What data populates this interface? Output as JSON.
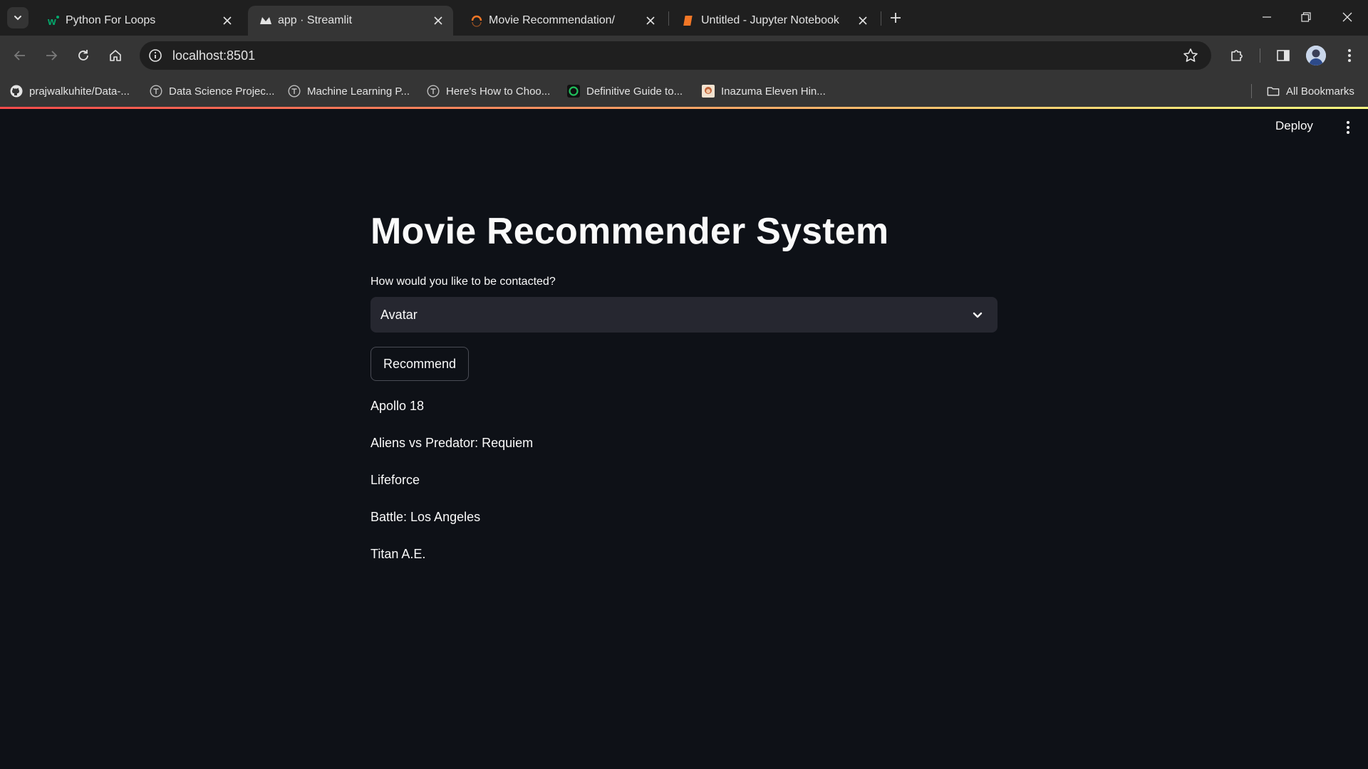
{
  "browser": {
    "tabs": [
      {
        "title": "Python For Loops",
        "icon": "w3schools-icon",
        "active": false
      },
      {
        "title": "app · Streamlit",
        "icon": "streamlit-crown-icon",
        "active": true
      },
      {
        "title": "Movie Recommendation/",
        "icon": "jupyter-loading-icon",
        "active": false
      },
      {
        "title": "Untitled - Jupyter Notebook",
        "icon": "jupyter-book-icon",
        "active": false
      }
    ],
    "address": "localhost:8501",
    "bookmarks": [
      {
        "label": "prajwalkuhite/Data-...",
        "icon": "github-icon"
      },
      {
        "label": "Data Science Projec...",
        "icon": "t-circle-icon"
      },
      {
        "label": "Machine Learning P...",
        "icon": "t-circle-icon"
      },
      {
        "label": "Here's How to Choo...",
        "icon": "t-circle-icon"
      },
      {
        "label": "Definitive Guide to...",
        "icon": "green-ring-icon"
      },
      {
        "label": "Inazuma Eleven Hin...",
        "icon": "image-thumbnail-icon"
      }
    ],
    "all_bookmarks": "All Bookmarks"
  },
  "app": {
    "deploy_label": "Deploy",
    "title": "Movie Recommender System",
    "select_label": "How would you like to be contacted?",
    "select_value": "Avatar",
    "button_label": "Recommend",
    "recommendations": [
      "Apollo 18",
      "Aliens vs Predator: Requiem",
      "Lifeforce",
      "Battle: Los Angeles",
      "Titan A.E."
    ]
  },
  "colors": {
    "app_background": "#0e1117",
    "select_background": "#262730",
    "text": "#fafafa",
    "accent_gradient_start": "#ff4b4b",
    "accent_gradient_end": "#fffd80"
  }
}
